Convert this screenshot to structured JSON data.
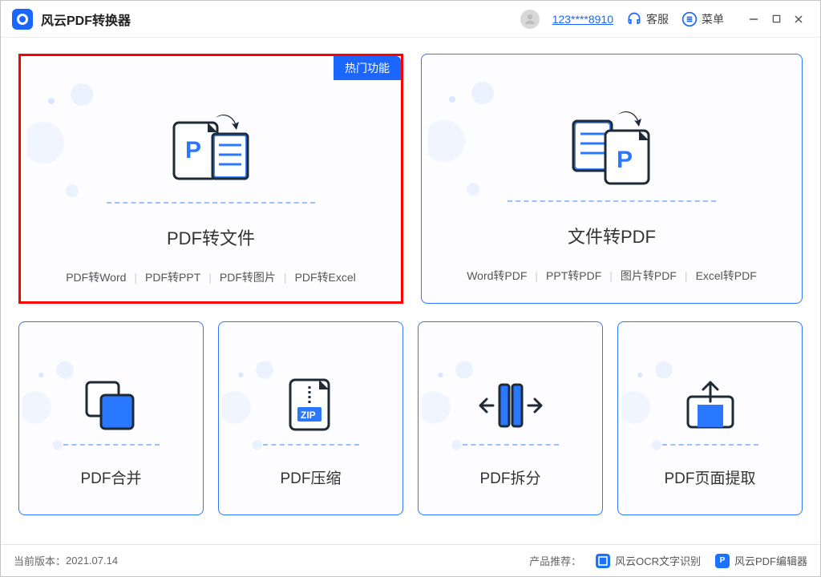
{
  "header": {
    "app_title": "风云PDF转换器",
    "user_id": "123****8910",
    "support_label": "客服",
    "menu_label": "菜单"
  },
  "cards": {
    "pdf_to_file": {
      "badge": "热门功能",
      "title": "PDF转文件",
      "subs": [
        "PDF转Word",
        "PDF转PPT",
        "PDF转图片",
        "PDF转Excel"
      ]
    },
    "file_to_pdf": {
      "title": "文件转PDF",
      "subs": [
        "Word转PDF",
        "PPT转PDF",
        "图片转PDF",
        "Excel转PDF"
      ]
    },
    "merge": {
      "title": "PDF合并"
    },
    "compress": {
      "title": "PDF压缩",
      "zip_label": "ZIP"
    },
    "split": {
      "title": "PDF拆分"
    },
    "extract": {
      "title": "PDF页面提取"
    }
  },
  "footer": {
    "version_label": "当前版本：",
    "version": "2021.07.14",
    "reco_label": "产品推荐：",
    "ocr": "风云OCR文字识别",
    "editor": "风云PDF编辑器"
  }
}
